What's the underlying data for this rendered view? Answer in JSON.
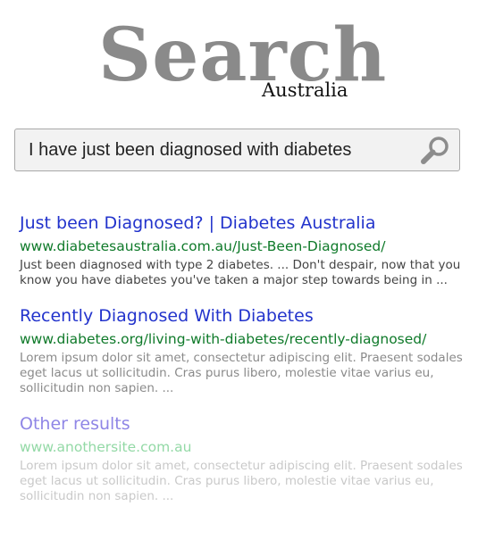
{
  "logo": {
    "title": "Search",
    "subtitle": "Australia"
  },
  "search": {
    "query": "I have just been diagnosed with diabetes",
    "button_icon": "magnifier-icon"
  },
  "results": [
    {
      "title": "Just been Diagnosed? | Diabetes Australia",
      "url": "www.diabetesaustralia.com.au/Just-Been-Diagnosed/",
      "snippet": "Just been diagnosed with type 2 diabetes. ... Don't despair, now that you know you have diabetes you've taken a major step towards being in ..."
    },
    {
      "title": "Recently Diagnosed With Diabetes",
      "url": "www.diabetes.org/living-with-diabetes/recently-diagnosed/",
      "snippet": "Lorem ipsum dolor sit amet, consectetur adipiscing elit. Praesent sodales eget lacus ut sollicitudin. Cras purus libero, molestie vitae varius eu, sollicitudin non sapien. ..."
    },
    {
      "title": "Other results",
      "url": "www.anothersite.com.au",
      "snippet": "Lorem ipsum dolor sit amet, consectetur adipiscing elit. Praesent sodales eget lacus ut sollicitudin. Cras purus libero, molestie vitae varius eu, sollicitudin non sapien. ..."
    }
  ],
  "colors": {
    "title_link": "#2233cc",
    "url": "#0f7a2a",
    "logo": "#8a8a8a"
  }
}
